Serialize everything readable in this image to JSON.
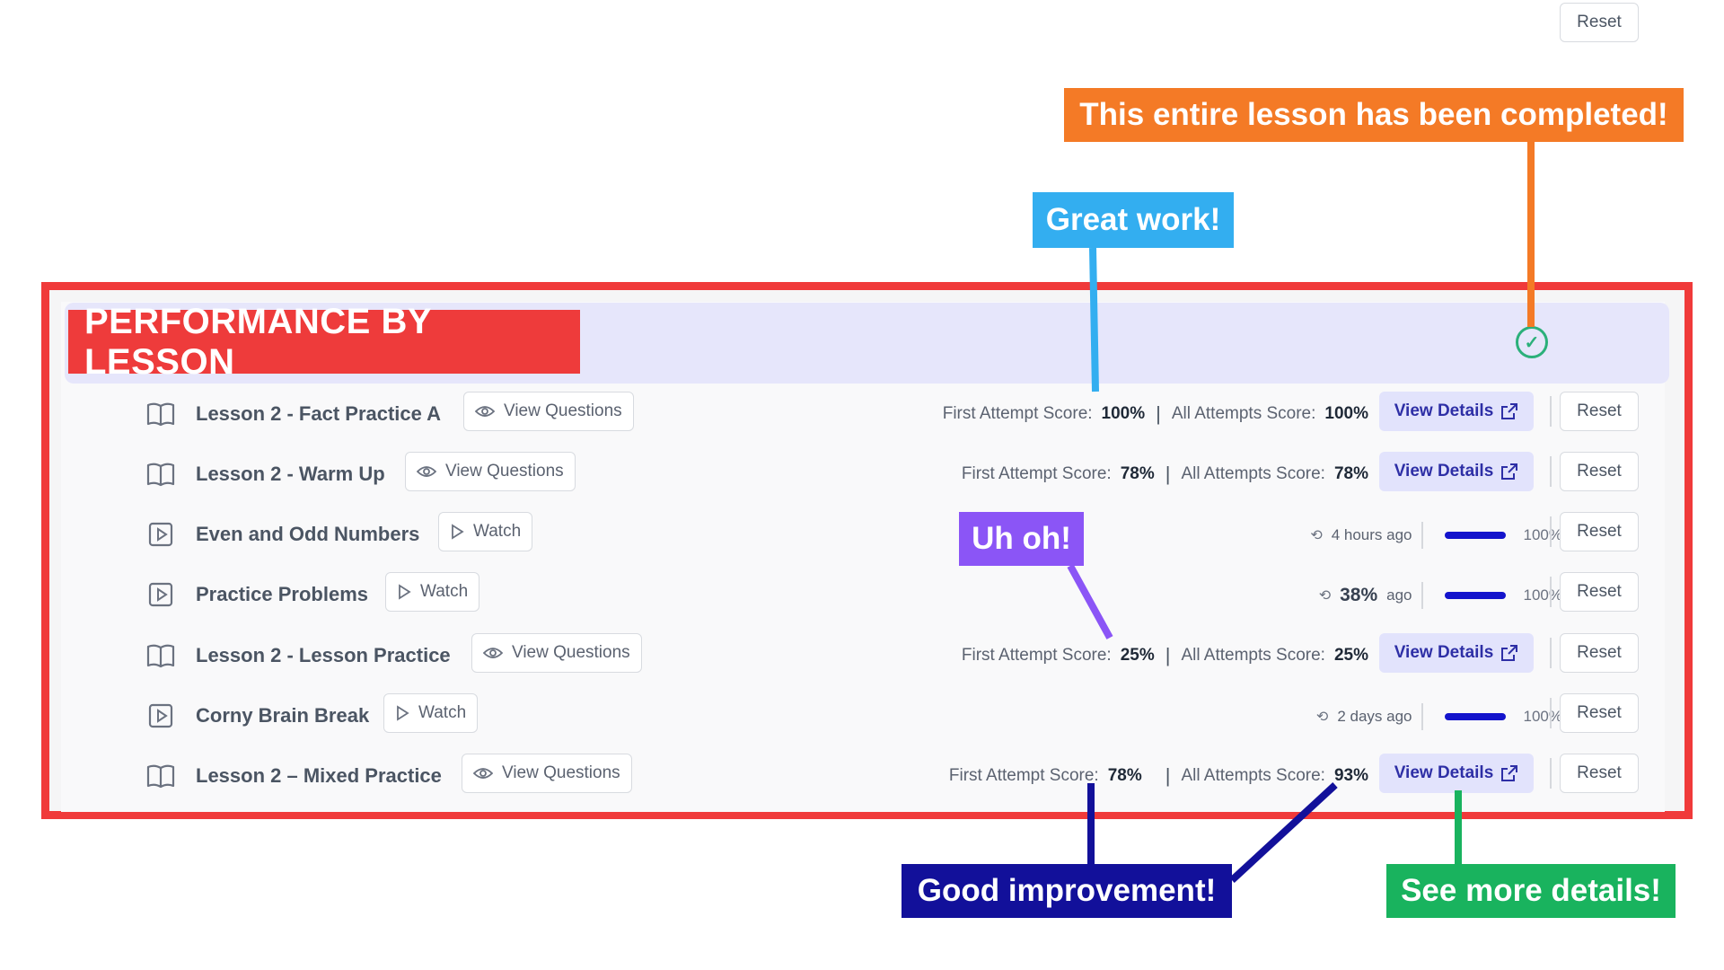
{
  "header": {
    "title": "PERFORMANCE BY LESSON",
    "reset_label": "Reset",
    "completed_icon": "check-circle-icon"
  },
  "rows": [
    {
      "type": "questions",
      "icon": "book-icon",
      "title": "Lesson 2 - Fact Practice A",
      "action_label": "View Questions",
      "first_attempt_label": "First Attempt Score:",
      "first_attempt_value": "100%",
      "all_attempts_label": "All Attempts Score:",
      "all_attempts_value": "100%",
      "details_label": "View Details",
      "reset_label": "Reset"
    },
    {
      "type": "questions",
      "icon": "book-icon",
      "title": "Lesson 2 - Warm Up",
      "action_label": "View Questions",
      "first_attempt_label": "First Attempt Score:",
      "first_attempt_value": "78%",
      "all_attempts_label": "All Attempts Score:",
      "all_attempts_value": "78%",
      "details_label": "View Details",
      "reset_label": "Reset"
    },
    {
      "type": "video",
      "icon": "play-square-icon",
      "title": "Even and Odd Numbers",
      "action_label": "Watch",
      "time_text": "4 hours ago",
      "progress_pct": 100,
      "progress_label": "100%",
      "reset_label": "Reset"
    },
    {
      "type": "video",
      "icon": "play-square-icon",
      "title": "Practice Problems",
      "action_label": "Watch",
      "time_text_strong": "38%",
      "time_text": "ago",
      "progress_pct": 100,
      "progress_label": "100%",
      "reset_label": "Reset"
    },
    {
      "type": "questions",
      "icon": "book-icon",
      "title": "Lesson 2 - Lesson Practice",
      "action_label": "View Questions",
      "first_attempt_label": "First Attempt Score:",
      "first_attempt_value": "25%",
      "all_attempts_label": "All Attempts Score:",
      "all_attempts_value": "25%",
      "details_label": "View Details",
      "reset_label": "Reset"
    },
    {
      "type": "video",
      "icon": "play-square-icon",
      "title": "Corny Brain Break",
      "action_label": "Watch",
      "time_text": "2 days ago",
      "progress_pct": 100,
      "progress_label": "100%",
      "reset_label": "Reset"
    },
    {
      "type": "questions",
      "icon": "book-icon",
      "title": "Lesson 2 – Mixed Practice",
      "action_label": "View Questions",
      "first_attempt_label": "First Attempt Score:",
      "first_attempt_value": "78%",
      "all_attempts_label": "All Attempts Score:",
      "all_attempts_value": "93%",
      "details_label": "View Details",
      "reset_label": "Reset"
    }
  ],
  "callouts": {
    "completed": "This entire lesson has been completed!",
    "great_work": "Great work!",
    "uh_oh": "Uh oh!",
    "improvement": "Good improvement!",
    "details": "See more details!"
  },
  "colors": {
    "frame_red": "#f03a3a",
    "orange": "#f47a26",
    "blue": "#33aef0",
    "purple": "#8b55f6",
    "navy": "#12109a",
    "green": "#19b35e",
    "details_bg": "#e2e3fc",
    "details_text": "#2e2fa6",
    "progress_fill": "#1414cc"
  }
}
